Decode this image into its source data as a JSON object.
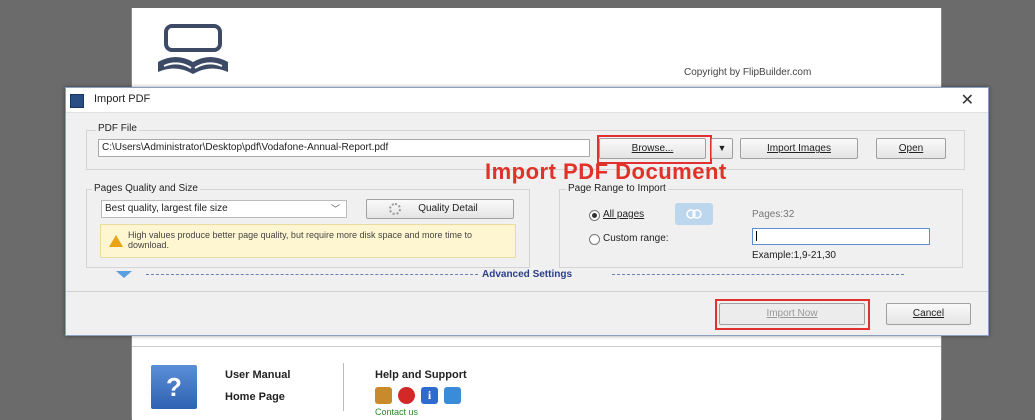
{
  "launcher": {
    "copyright": "Copyright by FlipBuilder.com",
    "user_manual": "User Manual",
    "home_page": "Home Page",
    "help_support": "Help and Support",
    "contact_us": "Contact us",
    "help_glyph": "?"
  },
  "dialog": {
    "title": "Import PDF",
    "close_glyph": "✕",
    "pdf_file_label": "PDF File",
    "pdf_path": "C:\\Users\\Administrator\\Desktop\\pdf\\Vodafone-Annual-Report.pdf",
    "browse": "Browse...",
    "dropdown_glyph": "▼",
    "import_images": "Import Images",
    "open": "Open",
    "annotation": "Import PDF Document",
    "quality_group_label": "Pages Quality and Size",
    "quality_value": "Best quality, largest file size",
    "quality_detail": "Quality Detail",
    "warning": "High values produce better page quality, but require more disk space and more time to download.",
    "range_group_label": "Page Range to Import",
    "all_pages": "All pages",
    "pages_count": "Pages:32",
    "custom_range": "Custom range:",
    "custom_range_value": "",
    "example": "Example:1,9-21,30",
    "advanced": "Advanced Settings",
    "import_now": "Import Now",
    "cancel": "Cancel"
  },
  "colors": {
    "annotation_red": "#e03228",
    "dialog_bg": "#f0f0f0",
    "advanced_text": "#2b3f8a"
  }
}
